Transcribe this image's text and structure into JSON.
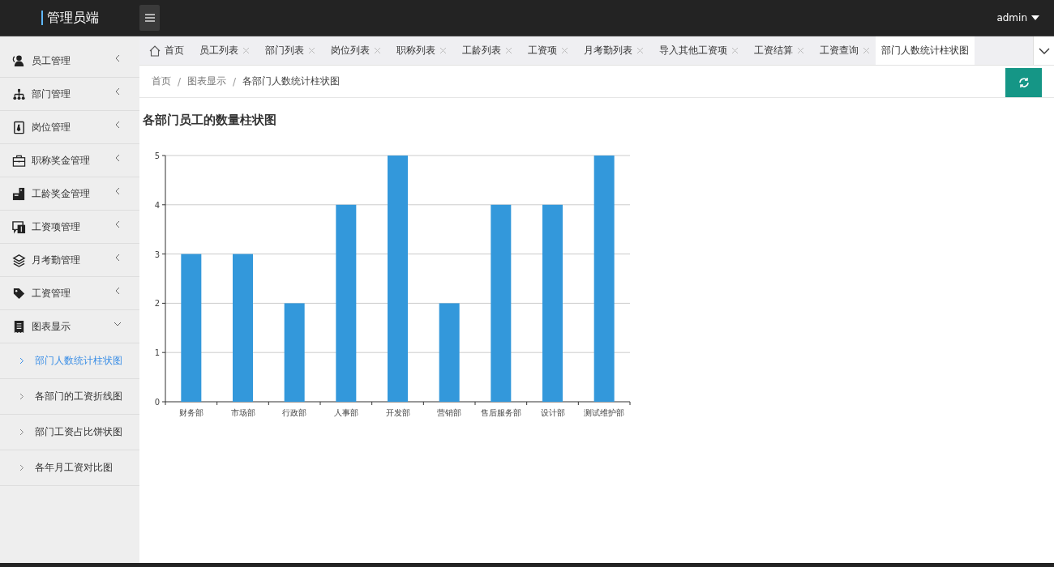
{
  "header": {
    "title": "管理员端",
    "user": "admin"
  },
  "sidebar": {
    "items": [
      {
        "label": "员工管理",
        "expanded": false
      },
      {
        "label": "部门管理",
        "expanded": false
      },
      {
        "label": "岗位管理",
        "expanded": false
      },
      {
        "label": "职称奖金管理",
        "expanded": false
      },
      {
        "label": "工龄奖金管理",
        "expanded": false
      },
      {
        "label": "工资项管理",
        "expanded": false
      },
      {
        "label": "月考勤管理",
        "expanded": false
      },
      {
        "label": "工资管理",
        "expanded": false
      },
      {
        "label": "图表显示",
        "expanded": true,
        "children": [
          {
            "label": "部门人数统计柱状图",
            "selected": true
          },
          {
            "label": "各部门的工资折线图",
            "selected": false
          },
          {
            "label": "部门工资占比饼状图",
            "selected": false
          },
          {
            "label": "各年月工资对比图",
            "selected": false
          }
        ]
      }
    ]
  },
  "tabs": [
    {
      "label": "首页",
      "kind": "home",
      "selected": false
    },
    {
      "label": "员工列表",
      "kind": "page",
      "selected": false
    },
    {
      "label": "部门列表",
      "kind": "page",
      "selected": false
    },
    {
      "label": "岗位列表",
      "kind": "page",
      "selected": false
    },
    {
      "label": "职称列表",
      "kind": "page",
      "selected": false
    },
    {
      "label": "工龄列表",
      "kind": "page",
      "selected": false
    },
    {
      "label": "工资项",
      "kind": "page",
      "selected": false
    },
    {
      "label": "月考勤列表",
      "kind": "page",
      "selected": false
    },
    {
      "label": "导入其他工资项",
      "kind": "page",
      "selected": false
    },
    {
      "label": "工资结算",
      "kind": "page",
      "selected": false
    },
    {
      "label": "工资查询",
      "kind": "page",
      "selected": false
    },
    {
      "label": "部门人数统计柱状图",
      "kind": "page",
      "selected": true
    }
  ],
  "breadcrumb": {
    "separator": "/",
    "items": [
      "首页",
      "图表显示",
      "各部门人数统计柱状图"
    ]
  },
  "content": {
    "title": "各部门员工的数量柱状图",
    "chart_data": {
      "type": "bar",
      "categories": [
        "财务部",
        "市场部",
        "行政部",
        "人事部",
        "开发部",
        "营销部",
        "售后服务部",
        "设计部",
        "测试维护部"
      ],
      "series": [
        {
          "color": "#3398db",
          "values": [
            3,
            3,
            2,
            4,
            5,
            2,
            4,
            4,
            5
          ]
        }
      ],
      "ylim": [
        0,
        5
      ],
      "yticks": [
        0,
        1,
        2,
        3,
        4,
        5
      ],
      "grid": true
    }
  }
}
